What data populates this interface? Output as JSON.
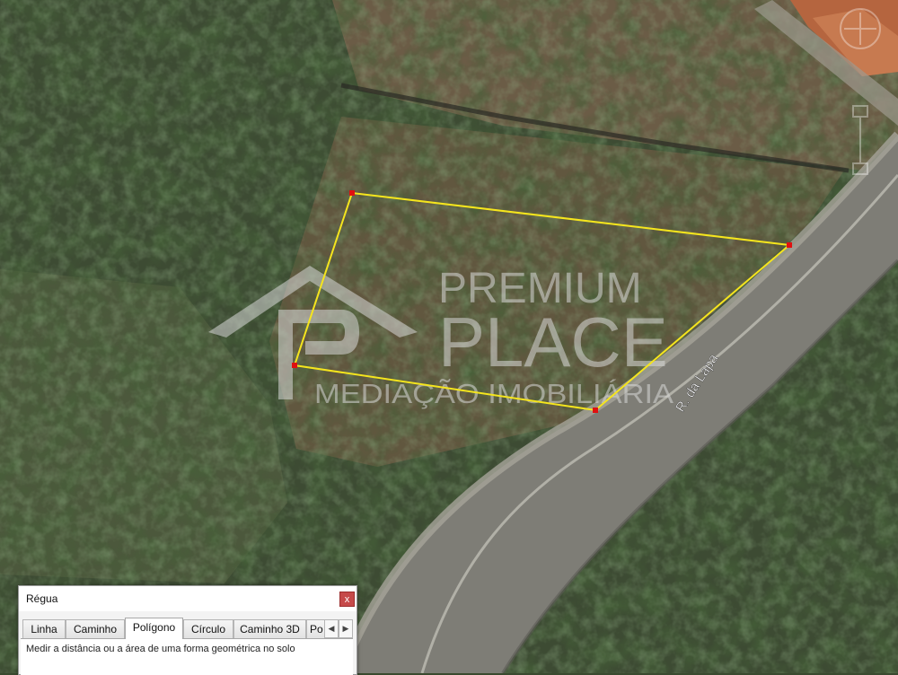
{
  "map": {
    "road_label": "R. da Lapa",
    "watermark": {
      "line1": "PREMIUM",
      "line2": "PLACE",
      "line3": "MEDIAÇÃO IMOBILIÁRIA"
    },
    "polygon_color": "#f5e51d",
    "vertex_color": "#e01010"
  },
  "ruler": {
    "title": "Régua",
    "close_glyph": "x",
    "tabs": [
      {
        "label": "Linha"
      },
      {
        "label": "Caminho"
      },
      {
        "label": "Polígono"
      },
      {
        "label": "Círculo"
      },
      {
        "label": "Caminho 3D"
      },
      {
        "label": "Po"
      }
    ],
    "active_tab": "Polígono",
    "scroll_left_glyph": "◀",
    "scroll_right_glyph": "▶",
    "description": "Medir a distância ou a área de uma forma geométrica no solo"
  }
}
